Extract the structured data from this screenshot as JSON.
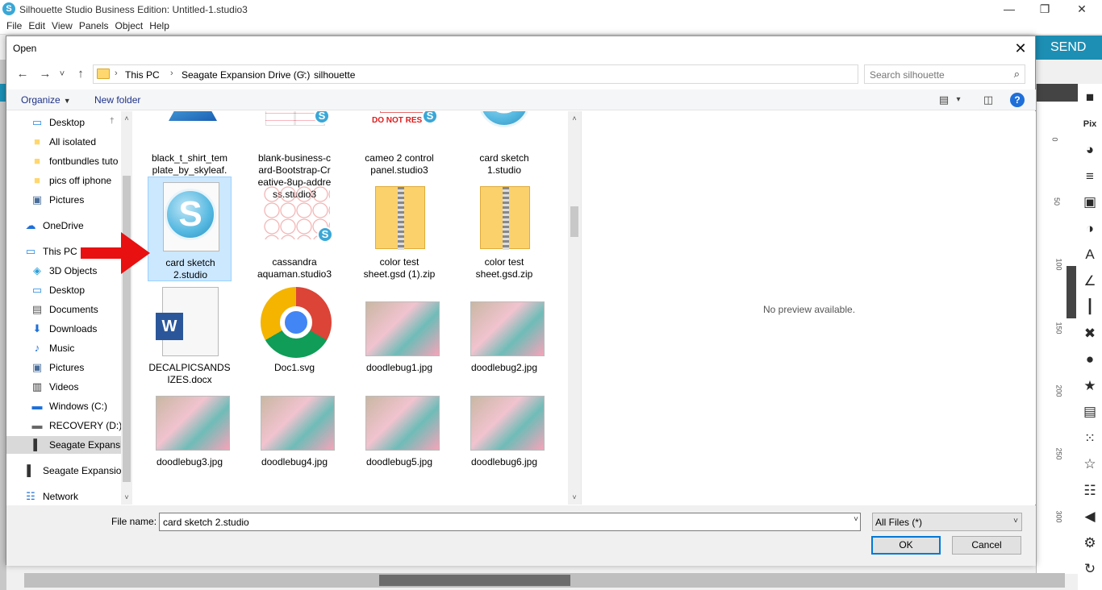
{
  "app": {
    "title": "Silhouette Studio Business Edition: Untitled-1.studio3",
    "logo_glyph": "S",
    "menus": [
      "File",
      "Edit",
      "View",
      "Panels",
      "Object",
      "Help"
    ],
    "send_label": "SEND",
    "window_controls": {
      "minimize": "—",
      "restore": "❐",
      "close": "✕"
    },
    "ruler_numbers": [
      "0",
      "50",
      "100",
      "150",
      "200",
      "250",
      "300"
    ],
    "tools": [
      "■",
      "Pix",
      "◕",
      "≡",
      "▣",
      "◑",
      "A",
      "∠",
      "┃",
      "✖",
      "●",
      "★",
      "▤",
      "⁙",
      "☆",
      "☷",
      "◀",
      "⚙",
      "↻"
    ],
    "tool_icon_names": [
      "page-setup",
      "pixscan",
      "fill-color",
      "line-style",
      "image-effects",
      "fill-gradient",
      "text-style",
      "sketch",
      "align",
      "replicate",
      "transform",
      "offset",
      "layers",
      "trace",
      "rhinestone",
      "puzzle",
      "collapse",
      "settings",
      "refresh"
    ]
  },
  "dialog": {
    "title": "Open",
    "close_glyph": "✕",
    "nav_buttons": [
      "←",
      "→",
      "˅",
      "↑"
    ],
    "breadcrumbs": [
      "This PC",
      "Seagate Expansion Drive (G:)",
      "silhouette"
    ],
    "crumb_sep": "›",
    "search_placeholder": "Search silhouette",
    "search_glyph": "⌕",
    "organize_label": "Organize",
    "organize_chev": "▼",
    "new_folder_label": "New folder",
    "view_glyphs": [
      "▤",
      "▾",
      "◫"
    ],
    "help_glyph": "?",
    "nav_items": [
      {
        "label": "Desktop",
        "icon": "desktop-icon",
        "glyph": "▭",
        "color": "#1e88e5",
        "indent": 1,
        "pinned": true
      },
      {
        "label": "All isolated",
        "icon": "folder-icon",
        "glyph": "■",
        "color": "#ffd76e",
        "indent": 1
      },
      {
        "label": "fontbundles tuto",
        "icon": "folder-icon",
        "glyph": "■",
        "color": "#ffd76e",
        "indent": 1
      },
      {
        "label": "pics off iphone",
        "icon": "folder-icon",
        "glyph": "■",
        "color": "#ffd76e",
        "indent": 1
      },
      {
        "label": "Pictures",
        "icon": "pictures-icon",
        "glyph": "▣",
        "color": "#4a6e9a",
        "indent": 1
      },
      {
        "label": "OneDrive",
        "icon": "onedrive-icon",
        "glyph": "☁",
        "color": "#1e6fd9",
        "indent": 0
      },
      {
        "label": "This PC",
        "icon": "this-pc-icon",
        "glyph": "▭",
        "color": "#1e88e5",
        "indent": 0
      },
      {
        "label": "3D Objects",
        "icon": "3d-objects-icon",
        "glyph": "◈",
        "color": "#2aa0d8",
        "indent": 1
      },
      {
        "label": "Desktop",
        "icon": "desktop-icon",
        "glyph": "▭",
        "color": "#1e88e5",
        "indent": 1
      },
      {
        "label": "Documents",
        "icon": "documents-icon",
        "glyph": "▤",
        "color": "#555",
        "indent": 1
      },
      {
        "label": "Downloads",
        "icon": "downloads-icon",
        "glyph": "⬇",
        "color": "#1e6fd9",
        "indent": 1
      },
      {
        "label": "Music",
        "icon": "music-icon",
        "glyph": "♪",
        "color": "#1e6fd9",
        "indent": 1
      },
      {
        "label": "Pictures",
        "icon": "pictures-icon",
        "glyph": "▣",
        "color": "#4a6e9a",
        "indent": 1
      },
      {
        "label": "Videos",
        "icon": "videos-icon",
        "glyph": "▥",
        "color": "#333",
        "indent": 1
      },
      {
        "label": "Windows (C:)",
        "icon": "drive-icon",
        "glyph": "▬",
        "color": "#1e6fd9",
        "indent": 1
      },
      {
        "label": "RECOVERY (D:)",
        "icon": "drive-icon",
        "glyph": "▬",
        "color": "#666",
        "indent": 1
      },
      {
        "label": "Seagate Expansio",
        "icon": "external-drive-icon",
        "glyph": "▌",
        "color": "#333",
        "indent": 1,
        "selected": true
      },
      {
        "label": "Seagate Expansion",
        "icon": "external-drive-icon",
        "glyph": "▌",
        "color": "#333",
        "indent": 0
      },
      {
        "label": "Network",
        "icon": "network-icon",
        "glyph": "☷",
        "color": "#1e6fd9",
        "indent": 0
      }
    ],
    "files": [
      {
        "name": "black_t_shirt_template_by_skyleaf.psd",
        "display": "black_t_shirt_tem plate_by_skyleaf. psd",
        "thumb": "affinity"
      },
      {
        "name": "blank-business-card-Bootstrap-Creative-8up-address.studio3",
        "display": "blank-business-c ard-Bootstrap-Cr eative-8up-addre ss.studio3",
        "thumb": "bizcard"
      },
      {
        "name": "cameo 2 control panel.studio3",
        "display": "cameo 2 control panel.studio3",
        "thumb": "cameo",
        "thumb_text": "DO NOT RES"
      },
      {
        "name": "card sketch 1.studio",
        "display": "card sketch 1.studio",
        "thumb": "silhouette"
      },
      {
        "name": "card sketch 2.studio",
        "display": "card sketch 2.studio",
        "thumb": "silhouette-doc",
        "selected": true
      },
      {
        "name": "cassandra aquaman.studio3",
        "display": "cassandra aquaman.studio3",
        "thumb": "petals"
      },
      {
        "name": "color test sheet.gsd (1).zip",
        "display": "color test sheet.gsd (1).zip",
        "thumb": "zip"
      },
      {
        "name": "color test sheet.gsd.zip",
        "display": "color test sheet.gsd.zip",
        "thumb": "zip"
      },
      {
        "name": "DECALPICSANDSIZES.docx",
        "display": "DECALPICSANDS IZES.docx",
        "thumb": "word"
      },
      {
        "name": "Doc1.svg",
        "display": "Doc1.svg",
        "thumb": "chrome"
      },
      {
        "name": "doodlebug1.jpg",
        "display": "doodlebug1.jpg",
        "thumb": "photo"
      },
      {
        "name": "doodlebug2.jpg",
        "display": "doodlebug2.jpg",
        "thumb": "photo"
      },
      {
        "name": "doodlebug3.jpg",
        "display": "doodlebug3.jpg",
        "thumb": "photo"
      },
      {
        "name": "doodlebug4.jpg",
        "display": "doodlebug4.jpg",
        "thumb": "photo"
      },
      {
        "name": "doodlebug5.jpg",
        "display": "doodlebug5.jpg",
        "thumb": "photo"
      },
      {
        "name": "doodlebug6.jpg",
        "display": "doodlebug6.jpg",
        "thumb": "photo"
      }
    ],
    "preview_text": "No preview available.",
    "filename_label": "File name:",
    "filename_value": "card sketch 2.studio",
    "filetype_value": "All Files (*)",
    "dropdown_glyph": "˅",
    "ok_label": "OK",
    "cancel_label": "Cancel",
    "scroll_up_glyph": "˄",
    "scroll_down_glyph": "˅"
  },
  "colors": {
    "accent": "#1d8fb4",
    "selection": "#cce8ff",
    "annotation_arrow": "#e81010"
  }
}
